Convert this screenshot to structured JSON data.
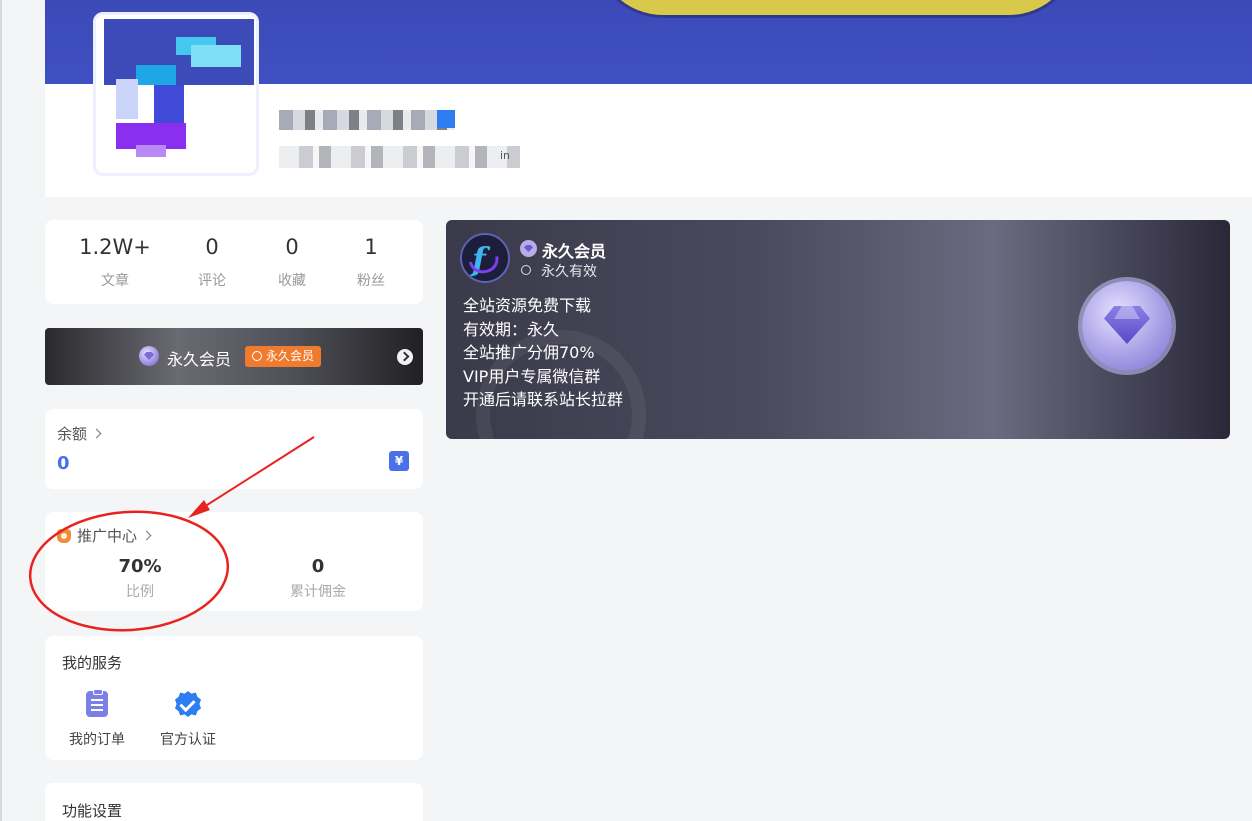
{
  "profile": {
    "desc_tail": "in"
  },
  "stats": [
    {
      "value": "1.2W+",
      "label": "文章"
    },
    {
      "value": "0",
      "label": "评论"
    },
    {
      "value": "0",
      "label": "收藏"
    },
    {
      "value": "1",
      "label": "粉丝"
    }
  ],
  "vip_bar": {
    "title": "永久会员",
    "tag": "永久会员"
  },
  "balance": {
    "title": "余额",
    "value": "0",
    "icon": "¥"
  },
  "promo": {
    "title": "推广中心",
    "ratio_value": "70%",
    "ratio_label": "比例",
    "commission_value": "0",
    "commission_label": "累计佣金"
  },
  "services": {
    "title": "我的服务",
    "items": [
      {
        "label": "我的订单",
        "icon": "clipboard-icon"
      },
      {
        "label": "官方认证",
        "icon": "verified-badge-icon"
      }
    ]
  },
  "settings": {
    "title": "功能设置"
  },
  "vip_card": {
    "title": "永久会员",
    "validity": "永久有效",
    "benefits": [
      "全站资源免费下载",
      "有效期：永久",
      "全站推广分佣70%",
      "VIP用户专属微信群",
      "开通后请联系站长拉群"
    ]
  },
  "colors": {
    "accent": "#4a72e8",
    "banner": "#3f50c2",
    "vip_tag": "#f07b2e",
    "annotation": "#e8231f"
  }
}
